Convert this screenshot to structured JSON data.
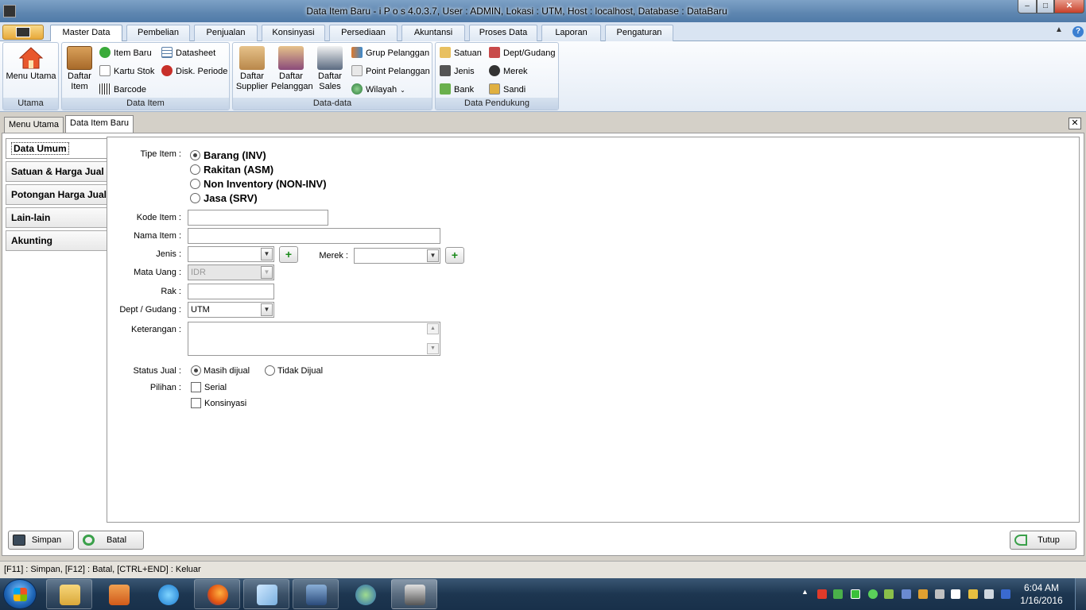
{
  "window": {
    "title": "Data Item Baru - i P o s 4.0.3.7,  User : ADMIN, Lokasi : UTM, Host : localhost, Database : DataBaru",
    "controls": {
      "minimize": "–",
      "maximize": "□",
      "close": "✕"
    }
  },
  "ribbon": {
    "tabs": [
      "Master Data",
      "Pembelian",
      "Penjualan",
      "Konsinyasi",
      "Persediaan",
      "Akuntansi",
      "Proses Data",
      "Laporan",
      "Pengaturan"
    ],
    "active_tab": "Master Data",
    "groups": {
      "utama": {
        "caption": "Utama",
        "menu_utama": "Menu Utama"
      },
      "data_item": {
        "caption": "Data Item",
        "daftar_item": "Daftar Item",
        "item_baru": "Item Baru",
        "kartu_stok": "Kartu Stok",
        "barcode": "Barcode",
        "datasheet": "Datasheet",
        "disk_periode": "Disk. Periode"
      },
      "data_data": {
        "caption": "Data-data",
        "daftar_supplier": "Daftar Supplier",
        "daftar_pelanggan": "Daftar Pelanggan",
        "daftar_sales": "Daftar Sales",
        "grup_pelanggan": "Grup Pelanggan",
        "point_pelanggan": "Point Pelanggan",
        "wilayah": "Wilayah"
      },
      "data_pendukung": {
        "caption": "Data Pendukung",
        "satuan": "Satuan",
        "jenis": "Jenis",
        "bank": "Bank",
        "dept_gudang": "Dept/Gudang",
        "merek": "Merek",
        "sandi": "Sandi"
      }
    }
  },
  "doc_tabs": [
    "Menu Utama",
    "Data Item Baru"
  ],
  "side_tabs": [
    "Data Umum",
    "Satuan & Harga Jual",
    "Potongan Harga Jual",
    "Lain-lain",
    "Akunting"
  ],
  "form": {
    "tipe_item_label": "Tipe Item :",
    "tipe_item_options": [
      "Barang (INV)",
      "Rakitan (ASM)",
      "Non Inventory (NON-INV)",
      "Jasa (SRV)"
    ],
    "tipe_item_selected": "Barang (INV)",
    "kode_item_label": "Kode Item :",
    "kode_item_value": "",
    "nama_item_label": "Nama Item :",
    "nama_item_value": "",
    "jenis_label": "Jenis :",
    "jenis_value": "",
    "merek_label": "Merek :",
    "merek_value": "",
    "mata_uang_label": "Mata Uang :",
    "mata_uang_value": "IDR",
    "rak_label": "Rak :",
    "rak_value": "",
    "dept_gudang_label": "Dept / Gudang :",
    "dept_gudang_value": "UTM",
    "keterangan_label": "Keterangan :",
    "status_jual_label": "Status Jual :",
    "status_jual_options": [
      "Masih dijual",
      "Tidak Dijual"
    ],
    "status_jual_selected": "Masih dijual",
    "pilihan_label": "Pilihan :",
    "pilihan_options": [
      "Serial",
      "Konsinyasi"
    ]
  },
  "buttons": {
    "simpan": "Simpan",
    "batal": "Batal",
    "tutup": "Tutup"
  },
  "status_bar": "[F11] : Simpan, [F12] : Batal, [CTRL+END] : Keluar",
  "taskbar": {
    "time": "6:04 AM",
    "date": "1/16/2016",
    "apps": [
      "file-explorer",
      "media-player",
      "internet-explorer",
      "firefox",
      "notepad",
      "remote-desktop",
      "network-globe",
      "ipos"
    ]
  },
  "colors": {
    "accent": "#5e86b0",
    "ribbon": "#d9e4f2",
    "taskbar": "#1d3650"
  }
}
